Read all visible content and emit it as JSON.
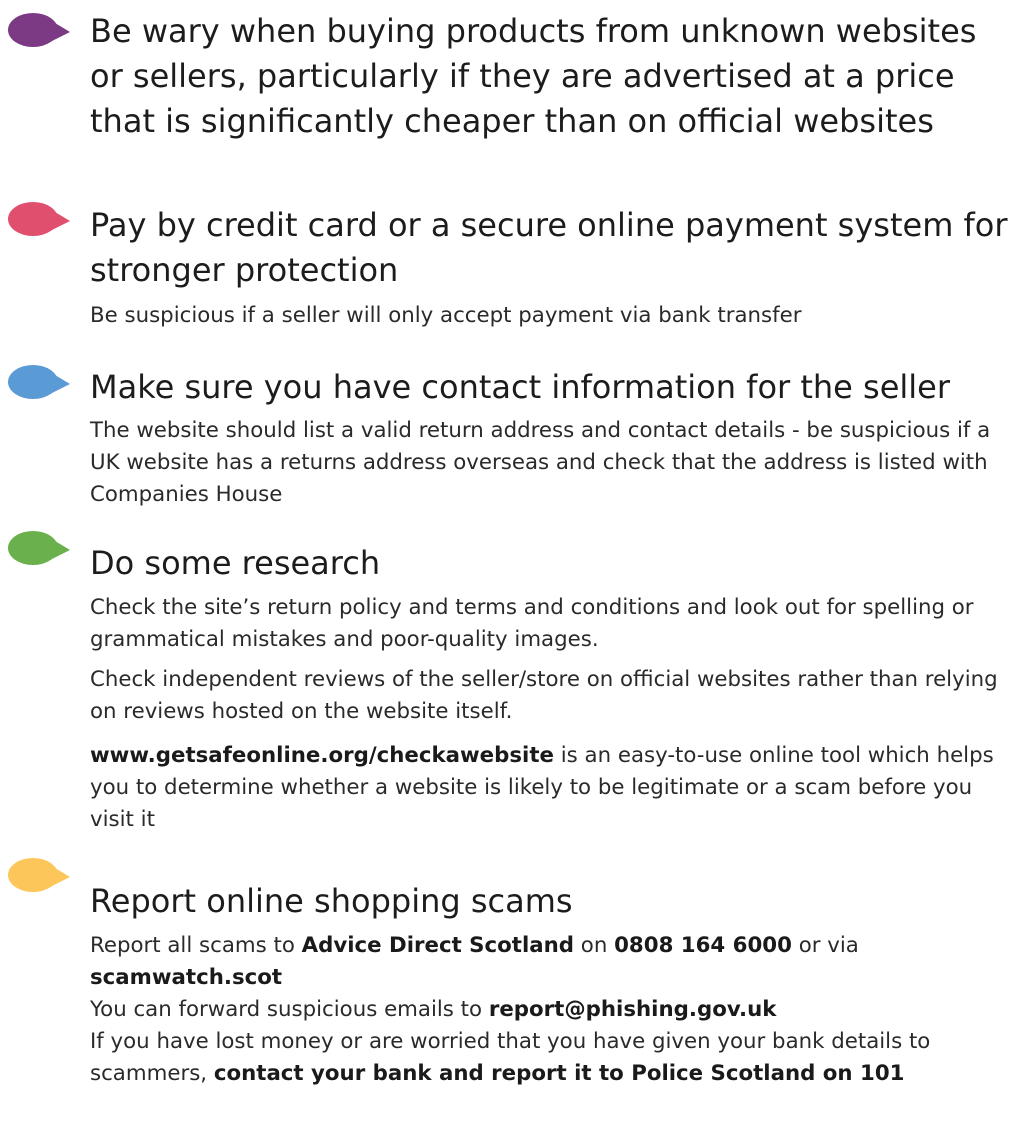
{
  "colors": {
    "purple": "#7b3a83",
    "pink": "#e0506e",
    "blue": "#5b9bd5",
    "green": "#6ab04c",
    "yellow": "#fcc65a",
    "text": "#1c1c1c"
  },
  "tips": [
    {
      "icon": "purple-speech-bubble-icon",
      "title": "Be wary when buying products from unknown websites or sellers, particularly if they are advertised at a price that is significantly cheaper than on official websites"
    },
    {
      "icon": "pink-speech-bubble-icon",
      "title": "Pay by credit card or a secure online payment system for stronger protection",
      "body": "Be suspicious if a seller will only accept payment via bank transfer"
    },
    {
      "icon": "blue-speech-bubble-icon",
      "title": "Make sure you have contact information for the seller",
      "body": "The website should list a valid return address and contact details - be suspicious if a UK website has a returns address overseas and check that the address is listed with Companies House"
    },
    {
      "icon": "green-speech-bubble-icon",
      "title": "Do some research",
      "p1": "Check the site’s return policy and terms and conditions and look out for spelling or grammatical mistakes and poor-quality images.",
      "p2": "Check independent reviews of the seller/store on official websites rather than relying on reviews hosted on the website itself.",
      "p3_link": "www.getsafeonline.org/checkawebsite",
      "p3_rest": " is an easy-to-use online tool which helps you to determine whether a website is likely to be legitimate or a scam before you visit it"
    },
    {
      "icon": "yellow-speech-bubble-icon",
      "title": "Report online shopping scams",
      "l1_a": "Report all scams to ",
      "l1_org": "Advice Direct Scotland",
      "l1_b": " on ",
      "l1_phone": "0808 164 6000",
      "l1_c": " or via ",
      "l1_site": "scamwatch.scot",
      "l2_a": "You can forward suspicious emails to ",
      "l2_email": "report@phishing.gov.uk",
      "l3_a": "If you have lost money or are worried that you have given your bank details to scammers, ",
      "l3_bold": "contact your bank and report it to Police Scotland on 101"
    }
  ]
}
